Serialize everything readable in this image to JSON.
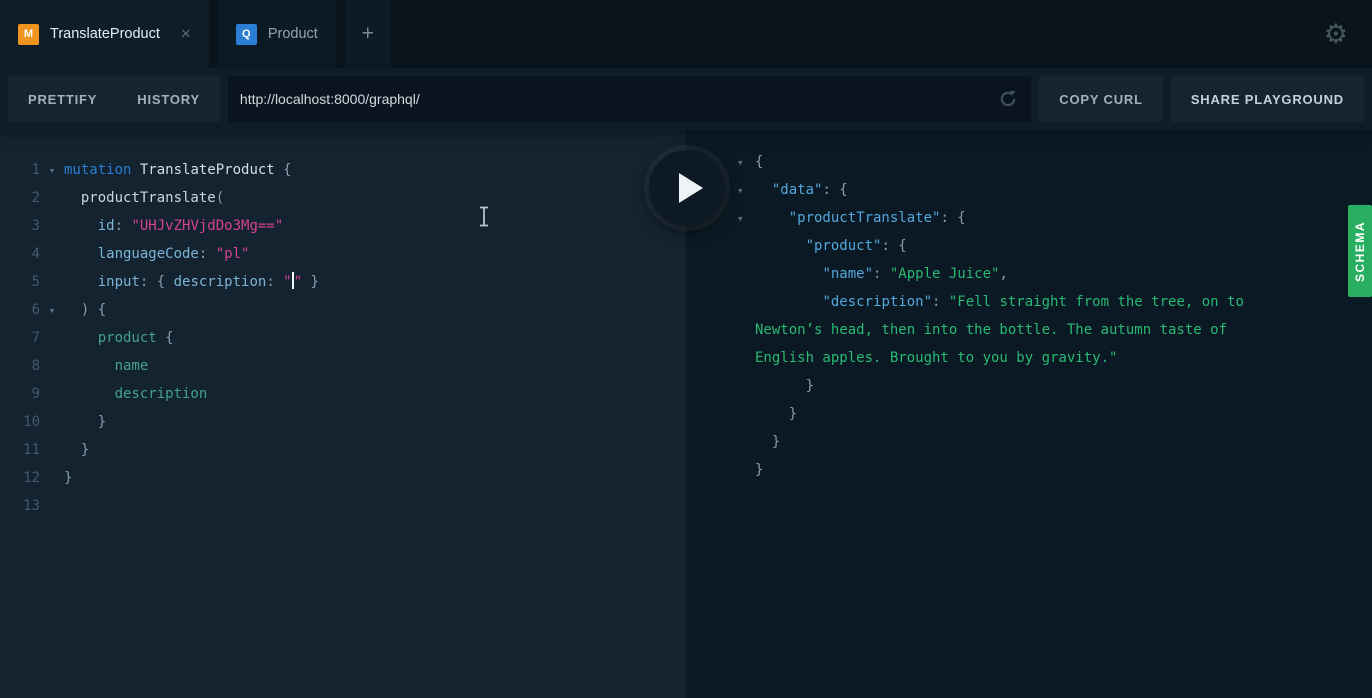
{
  "tabs": {
    "items": [
      {
        "badge": "M",
        "label": "TranslateProduct",
        "active": true
      },
      {
        "badge": "Q",
        "label": "Product",
        "active": false
      }
    ],
    "new_tab": "+"
  },
  "icons": {
    "gear": "⚙",
    "close": "×",
    "plus": "+",
    "fold": "▾"
  },
  "toolbar": {
    "prettify": "PRETTIFY",
    "history": "HISTORY",
    "url": "http://localhost:8000/graphql/",
    "copy_curl": "COPY CURL",
    "share": "SHARE PLAYGROUND"
  },
  "schema_tab": {
    "label": "SCHEMA"
  },
  "colors": {
    "mutation_badge": "#f0941f",
    "query_badge": "#2a7ed3",
    "schema_green": "#27ae60",
    "syntax": {
      "keyword": "#2a7ed3",
      "def": "#d5dee5",
      "fieldTop": "#ccd6dc",
      "field": "#45a189",
      "arg": "#7db4d6",
      "string": "#d64292",
      "punct": "#8b9caa",
      "plain": "#bfcbd3",
      "key": "#53a8dc",
      "value": "#29b973"
    }
  },
  "editor": {
    "lines": [
      {
        "n": "1",
        "fold": true,
        "tokens": [
          {
            "t": "mutation",
            "c": "keyword"
          },
          {
            "t": " ",
            "c": "plain"
          },
          {
            "t": "TranslateProduct",
            "c": "def"
          },
          {
            "t": " {",
            "c": "punct"
          }
        ]
      },
      {
        "n": "2",
        "tokens": [
          {
            "t": "  ",
            "c": "plain"
          },
          {
            "t": "productTranslate",
            "c": "fieldTop"
          },
          {
            "t": "(",
            "c": "punct"
          }
        ]
      },
      {
        "n": "3",
        "tokens": [
          {
            "t": "    ",
            "c": "plain"
          },
          {
            "t": "id",
            "c": "arg"
          },
          {
            "t": ": ",
            "c": "punct"
          },
          {
            "t": "\"UHJvZHVjdDo3Mg==\"",
            "c": "string"
          }
        ]
      },
      {
        "n": "4",
        "tokens": [
          {
            "t": "    ",
            "c": "plain"
          },
          {
            "t": "languageCode",
            "c": "arg"
          },
          {
            "t": ": ",
            "c": "punct"
          },
          {
            "t": "\"pl\"",
            "c": "string"
          }
        ]
      },
      {
        "n": "5",
        "tokens": [
          {
            "t": "    ",
            "c": "plain"
          },
          {
            "t": "input",
            "c": "arg"
          },
          {
            "t": ": ",
            "c": "punct"
          },
          {
            "t": "{ ",
            "c": "punct"
          },
          {
            "t": "description",
            "c": "arg"
          },
          {
            "t": ": ",
            "c": "punct"
          },
          {
            "t": "\"",
            "c": "string"
          },
          {
            "caret": true
          },
          {
            "t": "\"",
            "c": "string"
          },
          {
            "t": " }",
            "c": "punct"
          }
        ]
      },
      {
        "n": "6",
        "fold": true,
        "tokens": [
          {
            "t": "  ",
            "c": "plain"
          },
          {
            "t": ") {",
            "c": "punct"
          }
        ]
      },
      {
        "n": "7",
        "tokens": [
          {
            "t": "    ",
            "c": "plain"
          },
          {
            "t": "product",
            "c": "field"
          },
          {
            "t": " {",
            "c": "punct"
          }
        ]
      },
      {
        "n": "8",
        "tokens": [
          {
            "t": "      ",
            "c": "plain"
          },
          {
            "t": "name",
            "c": "field"
          }
        ]
      },
      {
        "n": "9",
        "tokens": [
          {
            "t": "      ",
            "c": "plain"
          },
          {
            "t": "description",
            "c": "field"
          }
        ]
      },
      {
        "n": "10",
        "tokens": [
          {
            "t": "    ",
            "c": "plain"
          },
          {
            "t": "}",
            "c": "punct"
          }
        ]
      },
      {
        "n": "11",
        "tokens": [
          {
            "t": "  ",
            "c": "plain"
          },
          {
            "t": "}",
            "c": "punct"
          }
        ]
      },
      {
        "n": "12",
        "tokens": [
          {
            "t": "}",
            "c": "punct"
          }
        ]
      },
      {
        "n": "13",
        "tokens": []
      }
    ]
  },
  "response": {
    "lines": [
      {
        "fold": true,
        "tokens": [
          {
            "t": "{",
            "c": "punct"
          }
        ]
      },
      {
        "fold": true,
        "tokens": [
          {
            "t": "  ",
            "c": "plain"
          },
          {
            "t": "\"data\"",
            "c": "key"
          },
          {
            "t": ": {",
            "c": "punct"
          }
        ]
      },
      {
        "fold": true,
        "tokens": [
          {
            "t": "    ",
            "c": "plain"
          },
          {
            "t": "\"productTranslate\"",
            "c": "key"
          },
          {
            "t": ": {",
            "c": "punct"
          }
        ]
      },
      {
        "tokens": [
          {
            "t": "      ",
            "c": "plain"
          },
          {
            "t": "\"product\"",
            "c": "key"
          },
          {
            "t": ": {",
            "c": "punct"
          }
        ]
      },
      {
        "tokens": [
          {
            "t": "        ",
            "c": "plain"
          },
          {
            "t": "\"name\"",
            "c": "key"
          },
          {
            "t": ": ",
            "c": "punct"
          },
          {
            "t": "\"Apple Juice\"",
            "c": "value"
          },
          {
            "t": ",",
            "c": "punct"
          }
        ]
      },
      {
        "tokens": [
          {
            "t": "        ",
            "c": "plain"
          },
          {
            "t": "\"description\"",
            "c": "key"
          },
          {
            "t": ": ",
            "c": "punct"
          },
          {
            "t": "\"Fell straight from the tree, on to",
            "c": "value"
          }
        ]
      },
      {
        "tokens": [
          {
            "t": "Newton’s head, then into the bottle. The autumn taste of",
            "c": "value"
          }
        ]
      },
      {
        "tokens": [
          {
            "t": "English apples. Brought to you by gravity.\"",
            "c": "value"
          }
        ]
      },
      {
        "tokens": [
          {
            "t": "      }",
            "c": "punct"
          }
        ]
      },
      {
        "tokens": [
          {
            "t": "    }",
            "c": "punct"
          }
        ]
      },
      {
        "tokens": [
          {
            "t": "  }",
            "c": "punct"
          }
        ]
      },
      {
        "tokens": [
          {
            "t": "}",
            "c": "punct"
          }
        ]
      }
    ]
  }
}
